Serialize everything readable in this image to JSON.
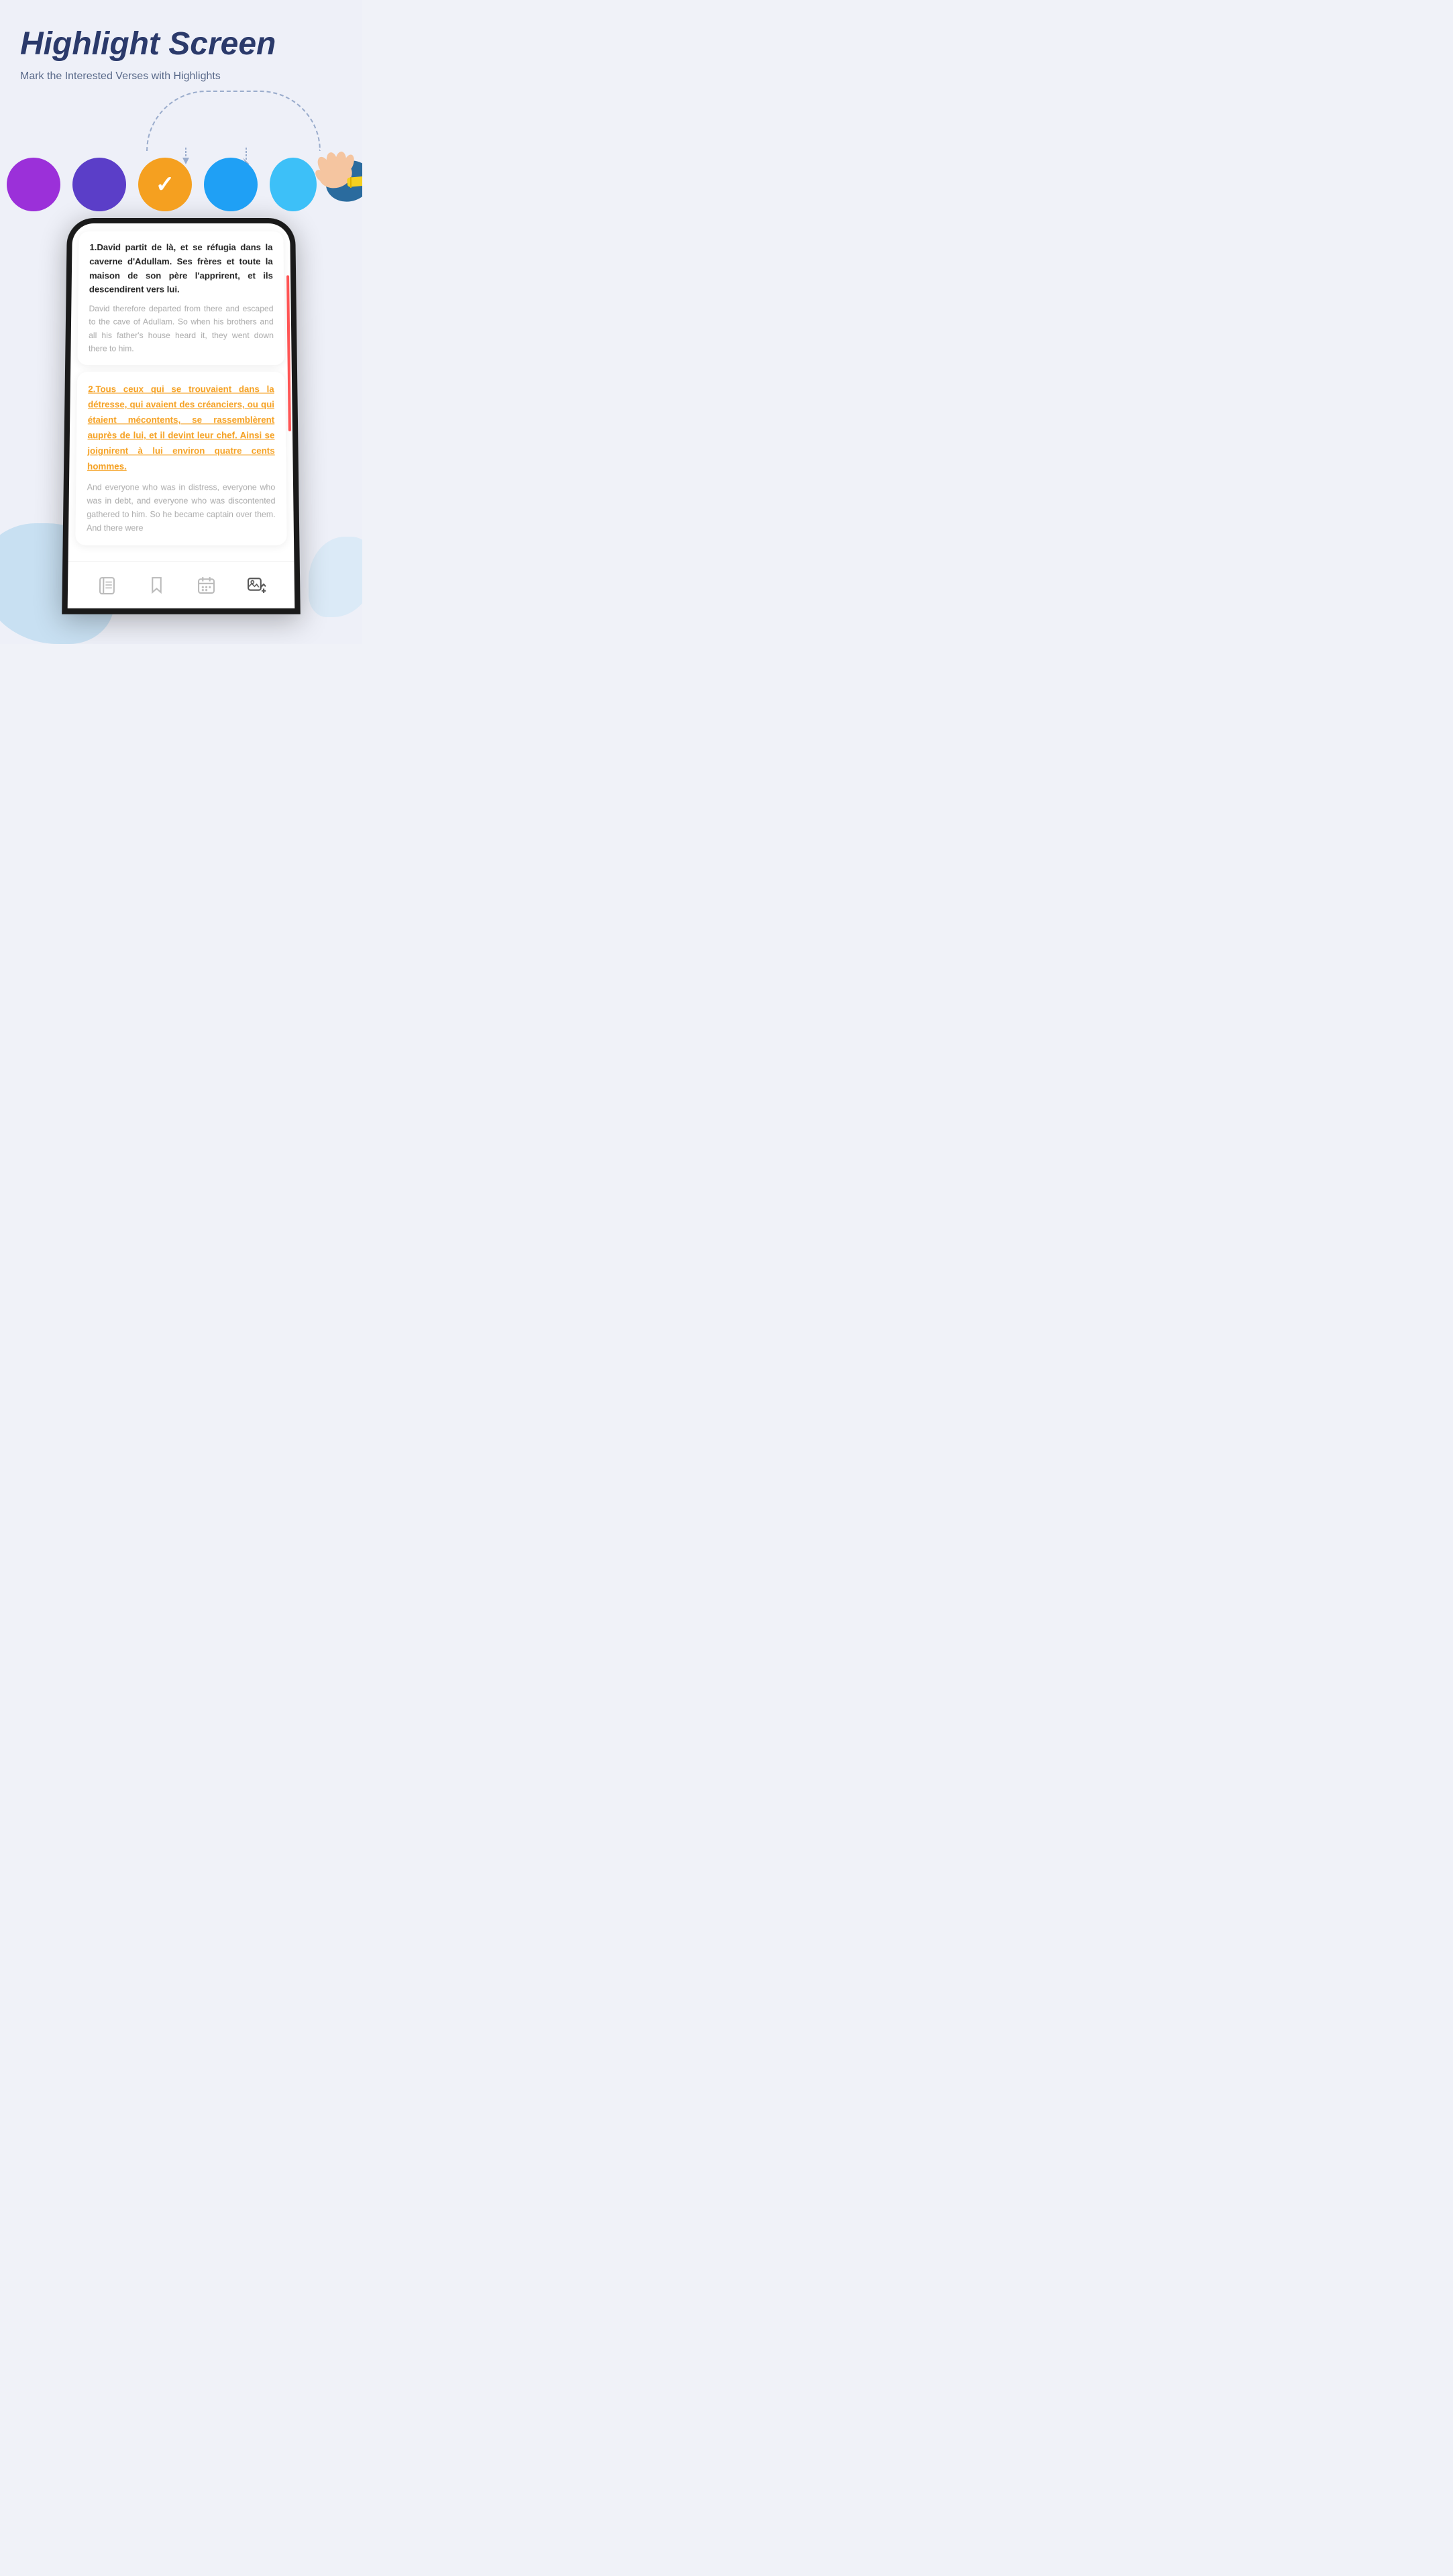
{
  "header": {
    "title": "Highlight Screen",
    "subtitle": "Mark the Interested Verses with Highlights"
  },
  "circles": [
    {
      "color": "purple-bright",
      "label": "Purple Bright",
      "selected": false
    },
    {
      "color": "purple-dark",
      "label": "Purple Dark",
      "selected": false
    },
    {
      "color": "orange",
      "label": "Orange",
      "selected": true
    },
    {
      "color": "blue-bright",
      "label": "Blue Bright",
      "selected": false
    },
    {
      "color": "blue-light",
      "label": "Blue Light",
      "selected": false
    }
  ],
  "verse1": {
    "french": "1.David partit de là, et se réfugia dans la caverne d'Adullam. Ses frères et toute la maison de son père l'apprirent, et ils descendirent vers lui.",
    "english": "David therefore departed from there and escaped to the cave of Adullam. So when his brothers and all his father's house heard it, they went down there to him."
  },
  "verse2": {
    "french_highlighted": "2.Tous ceux qui se trouvaient dans la détresse, qui avaient des créanciers, ou qui étaient mécontents, se rassemblèrent auprès de lui, et il devint leur chef. Ainsi se joignirent à lui environ quatre cents hommes.",
    "english": "And everyone who was in distress, everyone who was in debt, and everyone who was discontented gathered to him. So he became captain over them. And there were"
  },
  "bottom_nav": {
    "icons": [
      "book-icon",
      "bookmark-icon",
      "calendar-icon",
      "image-edit-icon"
    ]
  }
}
